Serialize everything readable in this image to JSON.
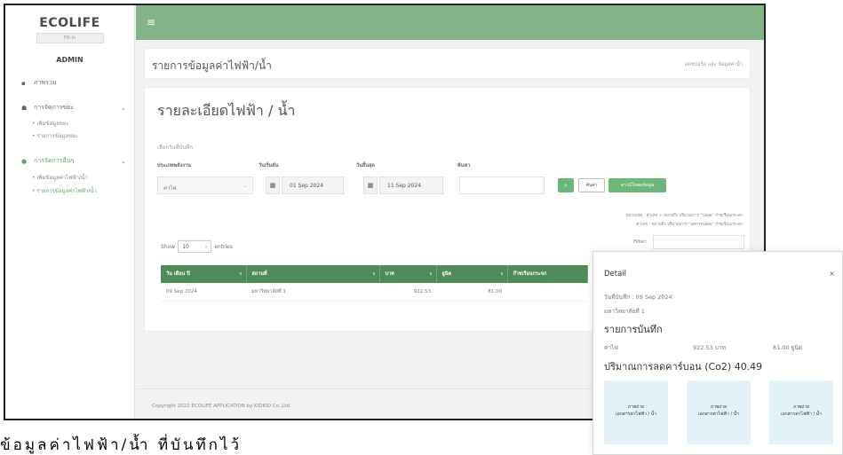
{
  "sidebar": {
    "brand": "ECOLIFE",
    "brand_sub": "Fill-in",
    "role": "ADMIN",
    "items": [
      {
        "label": "ภาพรวม",
        "icon": "dashboard-icon"
      },
      {
        "label": "การจัดการขยะ",
        "icon": "users-icon"
      },
      {
        "label": "การจัดการอื่นๆ",
        "icon": "drop-icon"
      }
    ],
    "sub_waste": [
      "• เพิ่มข้อมูลขยะ",
      "• รายการข้อมูลขยะ"
    ],
    "sub_other": [
      "• เพิ่มข้อมูลค่าไฟฟ้า/น้ำ",
      "• รายการข้อมูลค่าไฟฟ้า/น้ำ"
    ]
  },
  "topbar": {
    "menu_icon": "≡"
  },
  "header": {
    "title": "รายการข้อมูลค่าไฟฟ้า/น้ำ",
    "breadcrumb": "แดชบอร์ด และ ข้อมูลค่าน้ำ"
  },
  "main": {
    "title": "รายละเอียดไฟฟ้า / น้ำ",
    "subtitle": "เลือกวันที่บันทึก",
    "labels": {
      "type": "ประเภทพลังงาน",
      "start": "วันเริ่มต้น",
      "end": "วันสิ้นสุด",
      "search": "ค้นหา"
    },
    "type_value": "ค่าไฟ",
    "start_value": "01 Sep 2024",
    "end_value": "11 Sep 2024",
    "search_value": "",
    "btn_clear": "ค้นค่า",
    "btn_download": "ดาวน์โหลดข้อมูล",
    "note1": "หมายเหตุ : ตัวเลข + หมายถึง ปริมาณการ \"ปล่อย\" ก๊าซเรือนกระจก",
    "note2": "ตัวเลข - หมายถึง ปริมาณการ \"ลดการปล่อย\" ก๊าซเรือนกระจก",
    "filter_label": "Filter:",
    "show_label": "Show",
    "show_value": "10",
    "entries_label": "entries"
  },
  "table": {
    "headers": [
      "วัน เดือน ปี",
      "สถานที่",
      "บาท",
      "ยูนิต",
      "ก๊าซเรือนกระจก"
    ],
    "rows": [
      [
        "09 Sep 2024",
        "มหาวิทยาลัยที่ 1",
        "922.53",
        "81.00",
        ""
      ]
    ]
  },
  "footer": {
    "copyright": "Copyright 2022 ECOLIFE APPLICATION by KIDKID Co.,Ltd."
  },
  "popup": {
    "title": "Detail",
    "close": "×",
    "date_line": "วันที่บันทึก : 09 Sep 2024",
    "place": "มหาวิทยาลัยที่ 1",
    "record_heading": "รายการบันทึก",
    "item_name": "ค่าไฟ",
    "item_baht": "922.53 บาท",
    "item_unit": "81.00 ยูนิต",
    "co2_heading": "ปริมาณการลดคาร์บอน (Co2) 40.49",
    "thumb_title": "ภาพถ่าย",
    "thumb_sub": "เอกสารค่าไฟฟ้า / น้ำ"
  },
  "caption": "ข้อมูลค่าไฟฟ้า/น้ำ ที่บันทึกไว้"
}
